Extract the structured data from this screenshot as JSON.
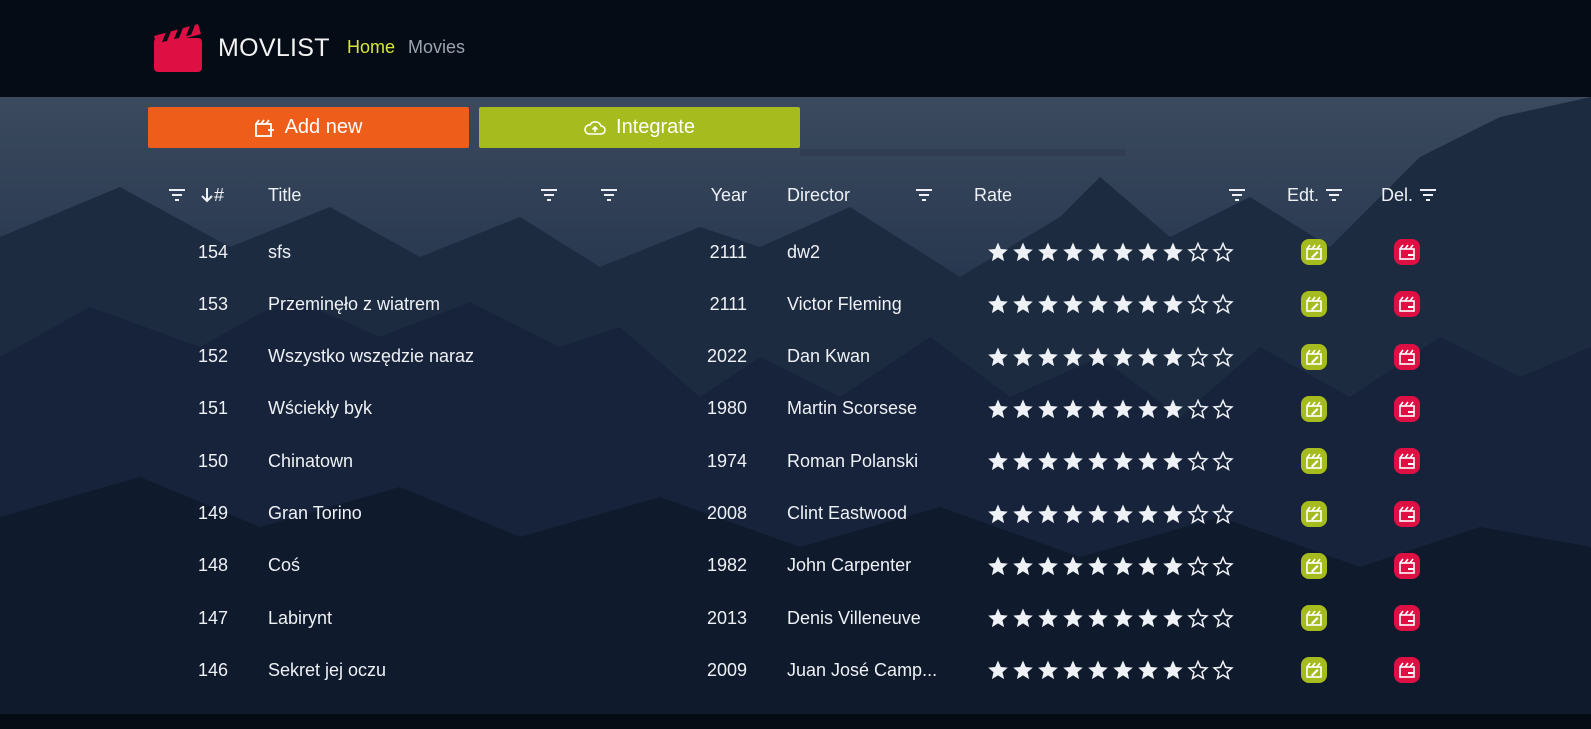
{
  "app": {
    "brand": "MOVLIST",
    "nav": [
      {
        "label": "Home",
        "active": true
      },
      {
        "label": "Movies",
        "active": false
      }
    ],
    "accent": "#d7e637",
    "logo_color": "#dd0f43"
  },
  "toolbar": {
    "add_label": "Add new",
    "add_color": "#ef5d1b",
    "integrate_label": "Integrate",
    "integrate_color": "#a6bb1d"
  },
  "table": {
    "columns": {
      "id": "#",
      "title": "Title",
      "year": "Year",
      "director": "Director",
      "rate": "Rate",
      "edit": "Edt.",
      "delete": "Del."
    },
    "rating_max": 10,
    "rows": [
      {
        "id": "154",
        "title": "sfs",
        "year": "2111",
        "director": "dw2",
        "rating": 8
      },
      {
        "id": "153",
        "title": "Przeminęło z wiatrem",
        "year": "2111",
        "director": "Victor Fleming",
        "rating": 8
      },
      {
        "id": "152",
        "title": "Wszystko wszędzie naraz",
        "year": "2022",
        "director": "Dan Kwan",
        "rating": 8
      },
      {
        "id": "151",
        "title": "Wściekły byk",
        "year": "1980",
        "director": "Martin Scorsese",
        "rating": 8
      },
      {
        "id": "150",
        "title": "Chinatown",
        "year": "1974",
        "director": "Roman Polanski",
        "rating": 8
      },
      {
        "id": "149",
        "title": "Gran Torino",
        "year": "2008",
        "director": "Clint Eastwood",
        "rating": 8
      },
      {
        "id": "148",
        "title": "Coś",
        "year": "1982",
        "director": "John Carpenter",
        "rating": 8
      },
      {
        "id": "147",
        "title": "Labirynt",
        "year": "2013",
        "director": "Denis Villeneuve",
        "rating": 8
      },
      {
        "id": "146",
        "title": "Sekret jej oczu",
        "year": "2009",
        "director": "Juan José Camp...",
        "rating": 8
      }
    ]
  },
  "icons": {
    "logo": "clapperboard-icon",
    "add": "clapperboard-plus-icon",
    "integrate": "cloud-upload-icon",
    "filter": "filter-icon",
    "sort": "arrow-down-icon",
    "star": "star-icon",
    "edit": "clapperboard-edit-icon",
    "delete": "clapperboard-delete-icon"
  }
}
